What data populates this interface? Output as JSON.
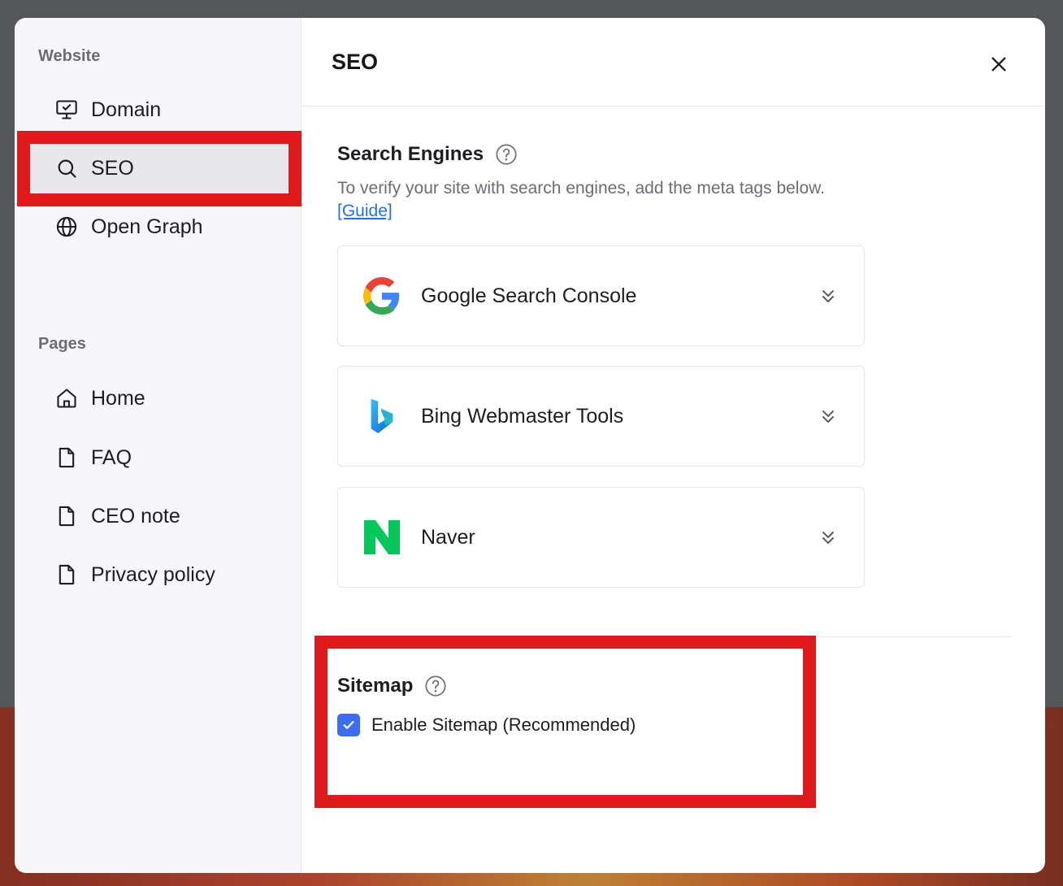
{
  "sidebar": {
    "website_label": "Website",
    "pages_label": "Pages",
    "website_items": [
      {
        "label": "Domain",
        "icon": "monitor-check-icon"
      },
      {
        "label": "SEO",
        "icon": "search-icon"
      },
      {
        "label": "Open Graph",
        "icon": "globe-icon"
      }
    ],
    "page_items": [
      {
        "label": "Home",
        "icon": "home-icon"
      },
      {
        "label": "FAQ",
        "icon": "file-icon"
      },
      {
        "label": "CEO note",
        "icon": "file-icon"
      },
      {
        "label": "Privacy policy",
        "icon": "file-icon"
      }
    ]
  },
  "main": {
    "title": "SEO",
    "search_engines": {
      "heading": "Search Engines",
      "description": "To verify your site with search engines, add the meta tags below.",
      "guide_link": "[Guide]",
      "engines": [
        {
          "name": "Google Search Console",
          "icon": "google-logo"
        },
        {
          "name": "Bing Webmaster Tools",
          "icon": "bing-logo"
        },
        {
          "name": "Naver",
          "icon": "naver-logo"
        }
      ]
    },
    "sitemap": {
      "heading": "Sitemap",
      "checkbox_label": "Enable Sitemap (Recommended)",
      "checked": true
    }
  },
  "colors": {
    "highlight": "#e0191a",
    "accent": "#3d6df2",
    "link": "#1e73e8",
    "naver_green": "#03c75a"
  }
}
